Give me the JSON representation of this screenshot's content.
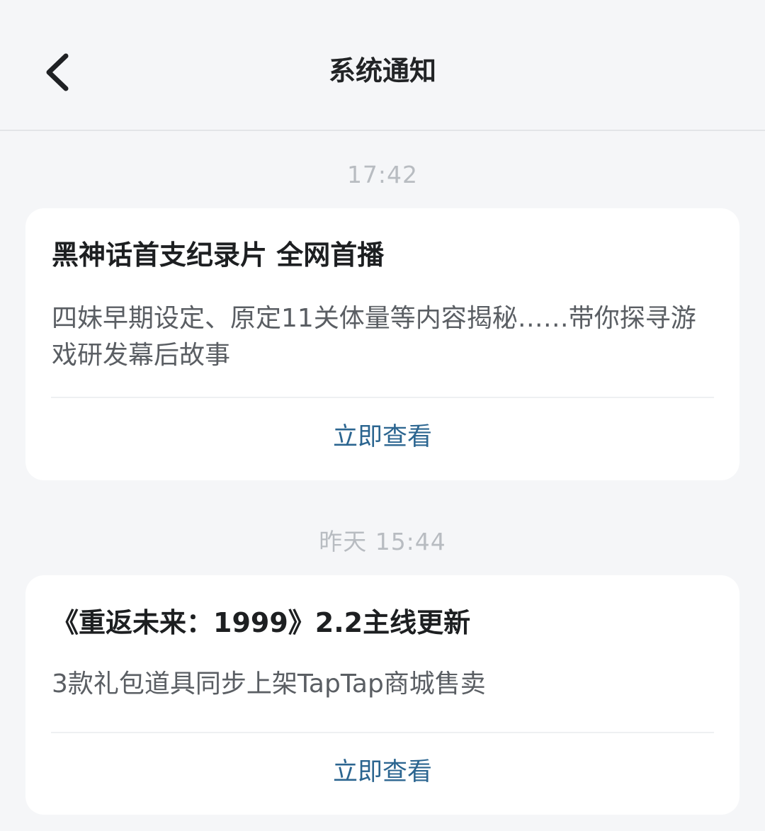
{
  "header": {
    "title": "系统通知",
    "back_icon": "chevron-left-icon"
  },
  "notifications": [
    {
      "time": "17:42",
      "title": "黑神话首支纪录片 全网首播",
      "body": "四妹早期设定、原定11关体量等内容揭秘……带你探寻游戏研发幕后故事",
      "action_label": "立即查看"
    },
    {
      "time": "昨天  15:44",
      "title": "《重返未来：1999》2.2主线更新",
      "body": "3款礼包道具同步上架TapTap商城售卖",
      "action_label": "立即查看"
    }
  ],
  "colors": {
    "background": "#f5f6f8",
    "card": "#ffffff",
    "action_link": "#2b6590",
    "timestamp": "#b8bcc1"
  }
}
